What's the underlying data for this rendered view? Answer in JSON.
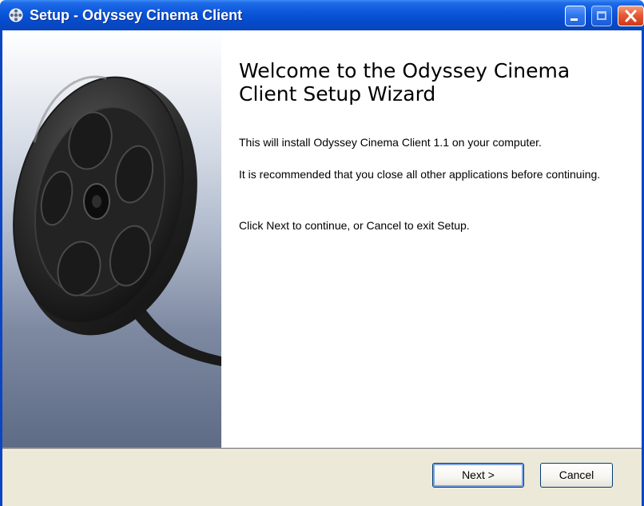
{
  "window": {
    "title": "Setup - Odyssey Cinema Client",
    "controls": [
      "minimize-icon",
      "maximize-icon",
      "close-icon"
    ]
  },
  "banner": {
    "image": "film-reel"
  },
  "content": {
    "heading": "Welcome to the Odyssey Cinema Client Setup Wizard",
    "paragraphs": [
      "This will install Odyssey Cinema Client 1.1 on your computer.",
      "It is recommended that you close all other applications before continuing.",
      "Click Next to continue, or Cancel to exit Setup."
    ]
  },
  "buttons": {
    "next": "Next >",
    "cancel": "Cancel"
  },
  "colors": {
    "titlebar": "#0a55d8",
    "close_button": "#e55a35",
    "button_face": "#ece9d8",
    "default_button_focus": "#7ba2e7"
  }
}
